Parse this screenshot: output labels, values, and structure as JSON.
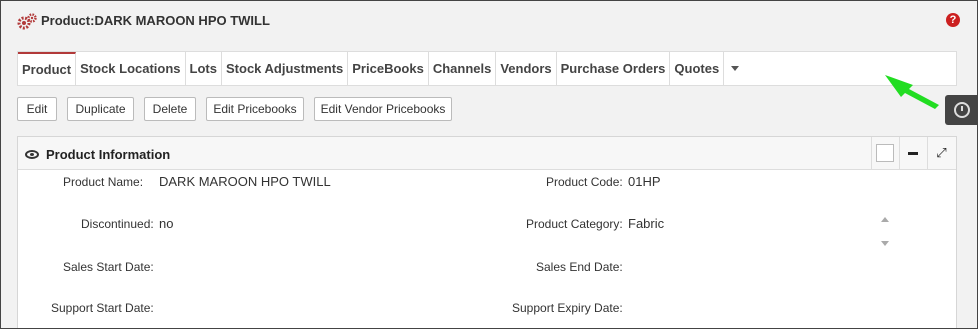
{
  "header": {
    "title": "Product:DARK MAROON HPO TWILL"
  },
  "tabs": [
    "Product",
    "Stock Locations",
    "Lots",
    "Stock Adjustments",
    "PriceBooks",
    "Channels",
    "Vendors",
    "Purchase Orders",
    "Quotes"
  ],
  "actions": [
    "Edit",
    "Duplicate",
    "Delete",
    "Edit Pricebooks",
    "Edit Vendor Pricebooks"
  ],
  "panel": {
    "title": "Product Information",
    "fields": {
      "product_name": {
        "label": "Product Name:",
        "value": "DARK MAROON HPO TWILL"
      },
      "product_code": {
        "label": "Product Code:",
        "value": "01HP"
      },
      "discontinued": {
        "label": "Discontinued:",
        "value": "no"
      },
      "product_category": {
        "label": "Product Category:",
        "value": "Fabric"
      },
      "sales_start_date": {
        "label": "Sales Start Date:",
        "value": ""
      },
      "sales_end_date": {
        "label": "Sales End Date:",
        "value": ""
      },
      "support_start_date": {
        "label": "Support Start Date:",
        "value": ""
      },
      "support_expiry_date": {
        "label": "Support Expiry Date:",
        "value": ""
      }
    }
  },
  "colors": {
    "accent": "#b23a3a",
    "help": "#cc2020",
    "arrow": "#22dd22"
  },
  "icons": [
    "gears-icon",
    "help-icon",
    "caret-down-icon",
    "history-clock-icon",
    "eye-icon",
    "checkbox-icon",
    "minimize-icon",
    "expand-icon",
    "scroll-up-icon",
    "scroll-down-icon"
  ]
}
